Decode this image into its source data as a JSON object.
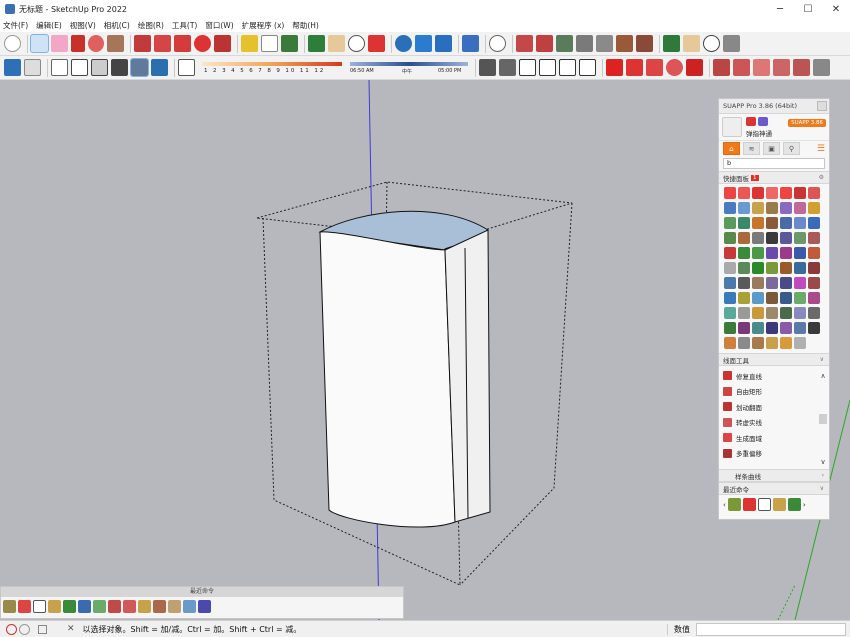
{
  "window": {
    "title": "无标题 - SketchUp Pro 2022",
    "min": "─",
    "max": "☐",
    "close": "✕"
  },
  "menu": [
    "文件(F)",
    "编辑(E)",
    "视图(V)",
    "相机(C)",
    "绘图(R)",
    "工具(T)",
    "窗口(W)",
    "扩展程序 (x)",
    "帮助(H)"
  ],
  "shadow": {
    "months": "1 2 3 4 5 6 7 8 9 10 11 12",
    "time_start": "06:50 AM",
    "noon": "中午",
    "time_end": "05:00 PM"
  },
  "suapp": {
    "title": "SUAPP Pro 3.86 (64bit)",
    "user_name": "弹指神通",
    "version_badge": "SUAPP 3.86",
    "search_value": "b",
    "quick_panel": {
      "title": "快捷面板",
      "badge": "1"
    },
    "line_tools": {
      "title": "线面工具",
      "items": [
        "修复直线",
        "自由矩形",
        "划动翻面",
        "转虚实线",
        "生成面域",
        "多重偏移"
      ]
    },
    "curve_tools": {
      "title": "样条曲线"
    },
    "recent": {
      "title": "最近命令"
    }
  },
  "recent_bar": {
    "title": "最近命令"
  },
  "status": {
    "hint": "以选择对象。Shift = 加/减。Ctrl = 加。Shift + Ctrl = 减。",
    "measure_label": "数值"
  },
  "colors": {
    "accent": "#f07a1a",
    "axis_blue": "#3b3bd6",
    "axis_green": "#2aa62a",
    "background": "#b7b8be"
  }
}
